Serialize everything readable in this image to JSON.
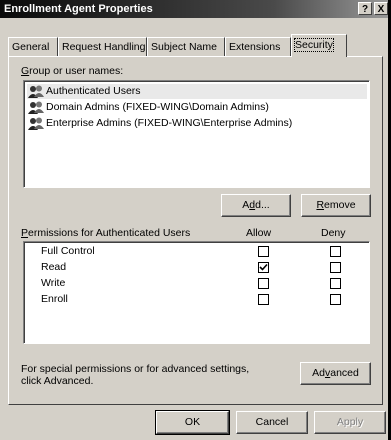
{
  "window": {
    "title": "Enrollment Agent Properties",
    "help_label": "?",
    "close_label": "X"
  },
  "tabs": [
    {
      "label": "General"
    },
    {
      "label": "Request Handling"
    },
    {
      "label": "Subject Name"
    },
    {
      "label": "Extensions"
    },
    {
      "label": "Security"
    }
  ],
  "group": {
    "label": "Group or user names:",
    "accel": "G",
    "rest": "roup or user names:",
    "items": [
      {
        "label": "Authenticated Users",
        "selected": true,
        "icon": "group-icon"
      },
      {
        "label": "Domain Admins (FIXED-WING\\Domain Admins)",
        "selected": false,
        "icon": "group-icon"
      },
      {
        "label": "Enterprise Admins (FIXED-WING\\Enterprise Admins)",
        "selected": false,
        "icon": "group-icon"
      }
    ]
  },
  "buttons": {
    "add": {
      "pre": "A",
      "accel": "d",
      "post": "d..."
    },
    "remove": {
      "pre": "",
      "accel": "R",
      "post": "emove"
    },
    "advanced": {
      "pre": "Ad",
      "accel": "v",
      "post": "anced"
    },
    "ok": "OK",
    "cancel": "Cancel",
    "apply": "Apply"
  },
  "permissions": {
    "header": {
      "accel": "P",
      "rest": "ermissions for Authenticated Users"
    },
    "allow_label": "Allow",
    "deny_label": "Deny",
    "rows": [
      {
        "label": "Full Control",
        "allow": false,
        "deny": false
      },
      {
        "label": "Read",
        "allow": true,
        "deny": false
      },
      {
        "label": "Write",
        "allow": false,
        "deny": false
      },
      {
        "label": "Enroll",
        "allow": false,
        "deny": false
      }
    ]
  },
  "advanced_note": {
    "line1": "For special permissions or for advanced settings,",
    "line2": "click Advanced."
  },
  "colors": {
    "face": "#d4d0c8",
    "shadow": "#404040",
    "highlight": "#ffffff",
    "selection": "#e9e9e9"
  }
}
